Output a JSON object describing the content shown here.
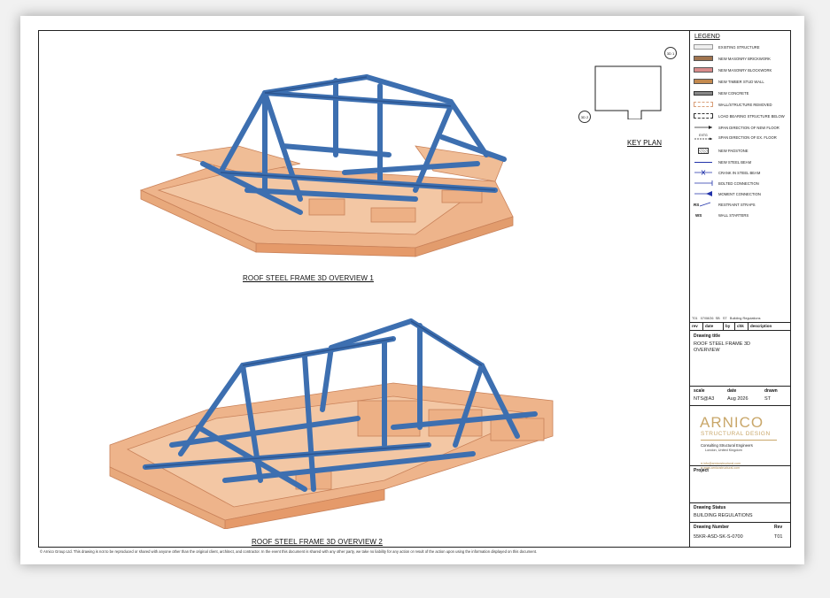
{
  "views": {
    "top_caption": "ROOF STEEL FRAME 3D OVERVIEW 1",
    "bottom_caption": "ROOF STEEL FRAME 3D OVERVIEW 2"
  },
  "key_plan": {
    "label": "KEY PLAN",
    "section1": "3D 1",
    "section2": "3D 2"
  },
  "legend": {
    "title": "LEGEND",
    "items": [
      {
        "label": "EXISTING STRUCTURE",
        "icon": "existing-structure-swatch"
      },
      {
        "label": "NEW MASONRY BRICKWORK",
        "icon": "brickwork-swatch"
      },
      {
        "label": "NEW MASONRY BLOCKWORK",
        "icon": "blockwork-swatch"
      },
      {
        "label": "NEW TIMBER STUD WALL",
        "icon": "timber-stud-swatch"
      },
      {
        "label": "NEW CONCRETE",
        "icon": "concrete-swatch"
      },
      {
        "label": "WALL/STRUCTURE REMOVED",
        "icon": "removed-swatch"
      },
      {
        "label": "LOAD BEARING STRUCTURE BELOW",
        "icon": "load-bearing-swatch"
      },
      {
        "label": "SPAN DIRECTION OF NEW FLOOR",
        "icon": "span-new-icon"
      },
      {
        "label": "SPAN DIRECTION OF EX. FLOOR",
        "icon": "span-existing-icon"
      },
      {
        "label": "NEW PADSTONE",
        "icon": "padstone-swatch"
      },
      {
        "label": "NEW STEEL BEAM",
        "icon": "steel-beam-icon"
      },
      {
        "label": "CRANK IN STEEL BEAM",
        "icon": "crank-icon"
      },
      {
        "label": "BOLTED CONNECTION",
        "icon": "bolted-connection-icon"
      },
      {
        "label": "MOMENT CONNECTION",
        "icon": "moment-connection-icon"
      },
      {
        "label": "RESTRAINT STRAPS",
        "icon": "restraint-strap-icon",
        "code": "RS"
      },
      {
        "label": "WALL STARTERS",
        "icon": "wall-starter-icon",
        "code": "WS"
      }
    ],
    "span_tag": "EXTG"
  },
  "revisions": {
    "row": {
      "rev": "T01",
      "date": "07/08/26",
      "by": "SB",
      "chk": "ST",
      "description": "Building Regulations"
    },
    "headers": [
      "rev",
      "date",
      "by",
      "chk",
      "description"
    ]
  },
  "title_block": {
    "drawing_title_label": "Drawing title",
    "drawing_title_line1": "ROOF STEEL FRAME 3D",
    "drawing_title_line2": "OVERVIEW",
    "scale_label": "scale",
    "scale_value": "NTS@A3",
    "date_label": "date",
    "date_value": "Aug 2026",
    "drawn_label": "drawn",
    "drawn_value": "ST",
    "project_label": "Project",
    "status_label": "Drawing Status",
    "status_value": "BUILDING REGULATIONS",
    "number_label": "Drawing Number",
    "number_value": "55KR-ASD-SK-S-0700",
    "rev_label": "Rev",
    "rev_value": "T01"
  },
  "company": {
    "name": "ARNICO",
    "subtitle": "STRUCTURAL DESIGN",
    "tagline": "Consulting Structural Engineers",
    "location": "London, United Kingdom",
    "email": "info@arnicostructural.com",
    "web": "www.arnicostructural.com"
  },
  "footer": "© Arnico Group Ltd. This drawing is not to be reproduced or shared with anyone other than the original client, architect, and contractor. In the event this document is shared with any other party, we take no liability for any action or result of the action upon using the information displayed on this document.",
  "colors": {
    "steel": "#3d6fb0",
    "steel_dark": "#2c5590",
    "timber": "#e8a97c",
    "timber_edge": "#c9825a",
    "brand": "#c9a76a"
  }
}
